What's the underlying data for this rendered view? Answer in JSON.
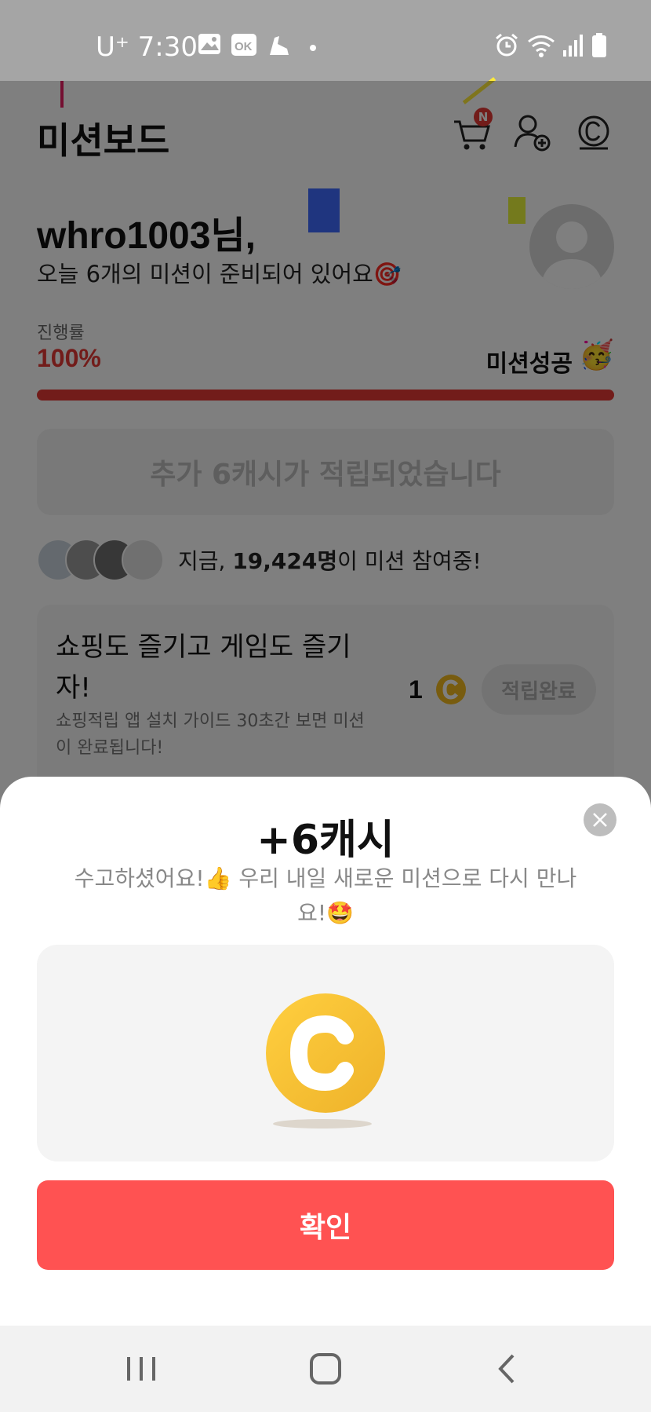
{
  "status_bar": {
    "carrier_time": "U⁺ 7:30",
    "icons": [
      "image-icon",
      "ok-icon",
      "sneaker-icon",
      "dot-icon",
      "alarm-icon",
      "wifi-icon",
      "signal-icon",
      "battery-icon"
    ]
  },
  "header": {
    "title": "미션보드",
    "cart_badge": "N",
    "icons": [
      "cart-icon",
      "add-friend-icon",
      "cash-icon"
    ]
  },
  "greeting": {
    "username": "whro1003님,",
    "subtitle": "오늘 6개의 미션이 준비되어 있어요🎯"
  },
  "progress": {
    "label": "진행률",
    "value_text": "100%",
    "fraction": 1.0,
    "status": "미션성공",
    "status_emoji": "🥳"
  },
  "bonus_banner": "추가 6캐시가 적립되었습니다",
  "participants": {
    "prefix": "지금, ",
    "count": "19,424명",
    "suffix": "이 미션 참여중!"
  },
  "mission_card": {
    "title": "쇼핑도 즐기고 게임도 즐기자!",
    "description": "쇼핑적립 앱 설치 가이드 30초간 보면 미션이 완료됩니다!",
    "reward": "1",
    "button_label": "적립완료"
  },
  "sheet": {
    "title": "+6캐시",
    "message": "수고하셨어요!👍 우리 내일 새로운 미션으로 다시 만나요!🤩",
    "confirm_label": "확인"
  },
  "colors": {
    "accent": "#ff5252",
    "progress": "#e53935",
    "coin": "#f5b921"
  },
  "navbar": {
    "icons": [
      "recent-apps-icon",
      "home-icon",
      "back-icon"
    ]
  }
}
